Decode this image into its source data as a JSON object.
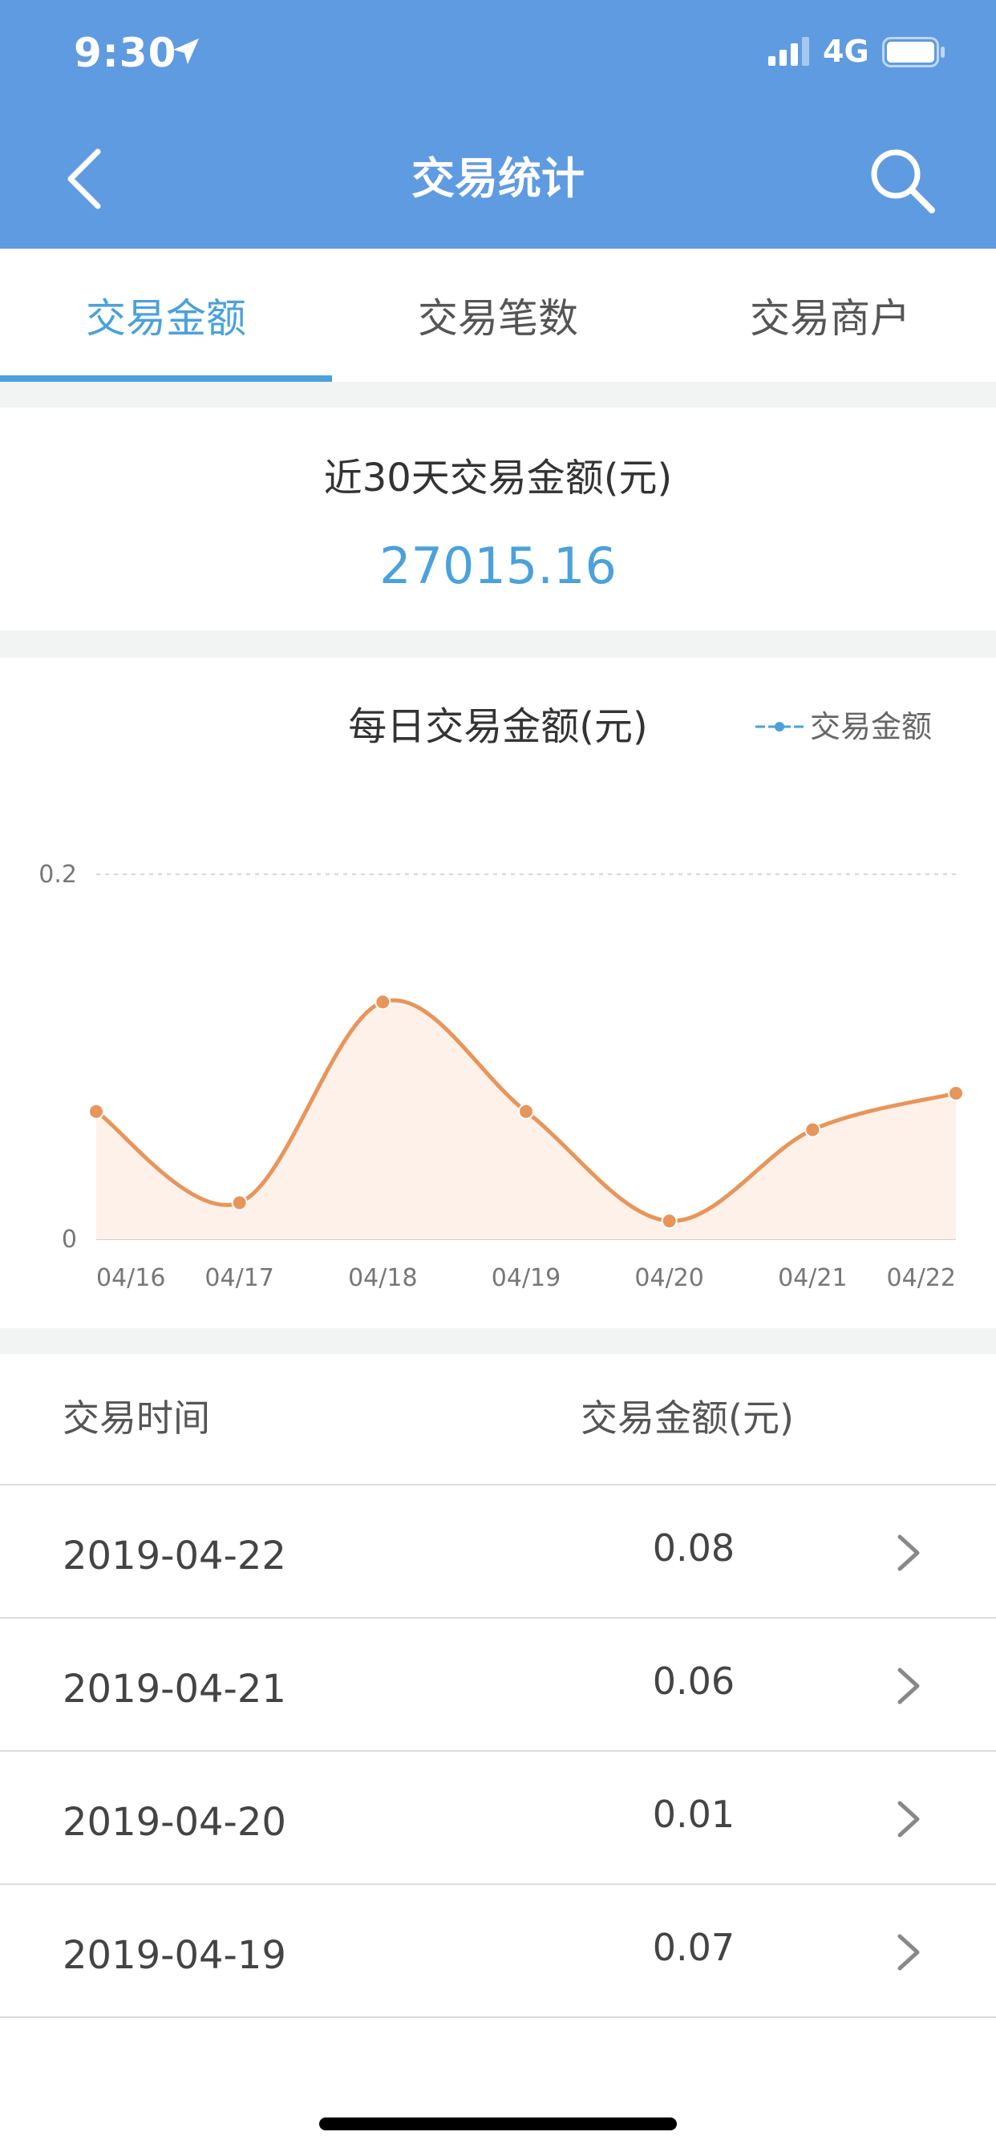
{
  "status_bar": {
    "time": "9:30",
    "network": "4G"
  },
  "header": {
    "title": "交易统计"
  },
  "tabs": [
    {
      "label": "交易金额",
      "active": true
    },
    {
      "label": "交易笔数",
      "active": false
    },
    {
      "label": "交易商户",
      "active": false
    }
  ],
  "summary": {
    "label": "近30天交易金额(元)",
    "value": "27015.16"
  },
  "chart_data": {
    "type": "line",
    "title": "每日交易金额(元)",
    "categories": [
      "04/16",
      "04/17",
      "04/18",
      "04/19",
      "04/20",
      "04/21",
      "04/22"
    ],
    "series": [
      {
        "name": "交易金额",
        "values": [
          0.07,
          0.02,
          0.13,
          0.07,
          0.01,
          0.06,
          0.08
        ]
      }
    ],
    "y_ticks": [
      "0",
      "0.2"
    ],
    "ylim": [
      0,
      0.2
    ],
    "legend": "top-right",
    "grid": true,
    "colors": {
      "line": "#e8955a",
      "area": "#fdf1ea",
      "legend_marker": "#4aa1dc"
    }
  },
  "table": {
    "headers": {
      "time": "交易时间",
      "amount": "交易金额(元)"
    },
    "rows": [
      {
        "date": "2019-04-22",
        "amount": "0.08"
      },
      {
        "date": "2019-04-21",
        "amount": "0.06"
      },
      {
        "date": "2019-04-20",
        "amount": "0.01"
      },
      {
        "date": "2019-04-19",
        "amount": "0.07"
      }
    ]
  },
  "colors": {
    "header_bg": "#5f9be1",
    "accent": "#4aa1dc",
    "divider_bg": "#f2f3f3"
  }
}
